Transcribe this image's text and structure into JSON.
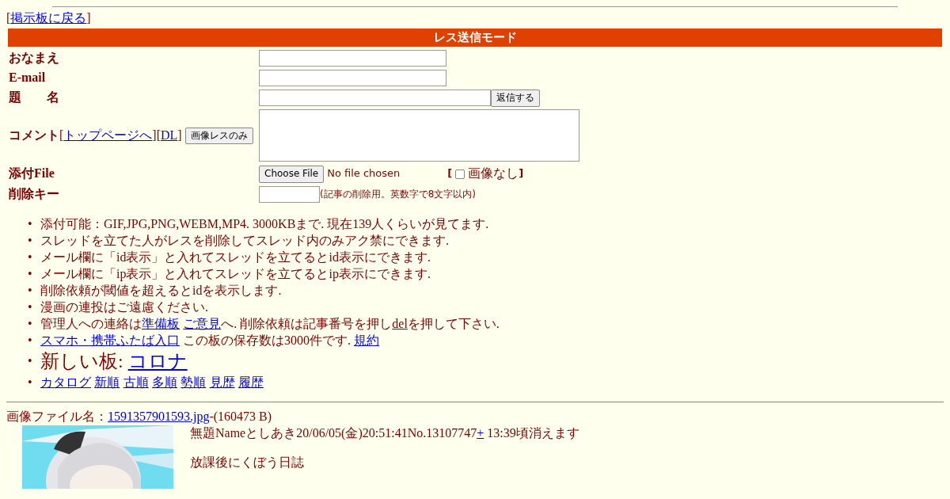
{
  "back_link": [
    {
      "kind": "text",
      "text": "["
    },
    {
      "kind": "link",
      "text": "掲示板に戻る"
    },
    {
      "kind": "text",
      "text": "]"
    }
  ],
  "form": {
    "title": "レス送信モード",
    "name": {
      "label": "おなまえ"
    },
    "email": {
      "label": "E-mail"
    },
    "subject": {
      "label": "題　　名",
      "button": "返信する"
    },
    "comment": {
      "label": "コメント",
      "links": [
        {
          "kind": "text",
          "text": "["
        },
        {
          "kind": "link",
          "text": "トップページへ"
        },
        {
          "kind": "text",
          "text": "]["
        },
        {
          "kind": "link",
          "text": "DL"
        },
        {
          "kind": "text",
          "text": "]"
        }
      ],
      "button": "画像レスのみ"
    },
    "file": {
      "label": "添付File",
      "button": "Choose File",
      "status": "No file chosen",
      "open": "[",
      "checkbox_label": "画像なし",
      "close": "]",
      "checked": false
    },
    "delete_key": {
      "label": "削除キー",
      "hint": "(記事の削除用。英数字で8文字以内)"
    }
  },
  "notes": [
    {
      "kind": "normal",
      "marker": "•",
      "parts": [
        {
          "kind": "text",
          "text": "添付可能：GIF,JPG,PNG,WEBM,MP4. 3000KBまで. 現在139人くらいが見てます."
        }
      ]
    },
    {
      "kind": "normal",
      "marker": "•",
      "parts": [
        {
          "kind": "text",
          "text": "スレッドを立てた人がレスを削除してスレッド内のみアク禁にできます."
        }
      ]
    },
    {
      "kind": "normal",
      "marker": "•",
      "parts": [
        {
          "kind": "text",
          "text": "メール欄に「id表示」と入れてスレッドを立てるとid表示にできます."
        }
      ]
    },
    {
      "kind": "normal",
      "marker": "•",
      "parts": [
        {
          "kind": "text",
          "text": "メール欄に「ip表示」と入れてスレッドを立てるとip表示にできます."
        }
      ]
    },
    {
      "kind": "normal",
      "marker": "•",
      "parts": [
        {
          "kind": "text",
          "text": "削除依頼が閾値を超えるとidを表示します."
        }
      ]
    },
    {
      "kind": "normal",
      "marker": "•",
      "parts": [
        {
          "kind": "text",
          "text": "漫画の連投はご遠慮ください."
        }
      ]
    },
    {
      "kind": "normal",
      "marker": "•",
      "parts": [
        {
          "kind": "text",
          "text": "管理人への連絡は"
        },
        {
          "kind": "link",
          "text": "準備板"
        },
        {
          "kind": "space"
        },
        {
          "kind": "link",
          "text": "ご意見"
        },
        {
          "kind": "text",
          "text": "へ. 削除依頼は記事番号を押し"
        },
        {
          "kind": "underline",
          "text": "del"
        },
        {
          "kind": "text",
          "text": "を押して下さい."
        }
      ]
    },
    {
      "kind": "normal",
      "marker": "•",
      "parts": [
        {
          "kind": "link",
          "text": "スマホ・携帯ふたば入口"
        },
        {
          "kind": "text",
          "text": " この板の保存数は3000件です. "
        },
        {
          "kind": "link",
          "text": "規約"
        }
      ]
    },
    {
      "kind": "large",
      "marker": "•",
      "parts": [
        {
          "kind": "text",
          "text": "新しい板: "
        },
        {
          "kind": "link",
          "text": "コロナ"
        }
      ]
    },
    {
      "kind": "normal",
      "marker": "•",
      "parts": [
        {
          "kind": "link",
          "text": "カタログ"
        },
        {
          "kind": "space"
        },
        {
          "kind": "link",
          "text": "新順"
        },
        {
          "kind": "space"
        },
        {
          "kind": "link",
          "text": "古順"
        },
        {
          "kind": "space"
        },
        {
          "kind": "link",
          "text": "多順"
        },
        {
          "kind": "space"
        },
        {
          "kind": "link",
          "text": "勢順"
        },
        {
          "kind": "space"
        },
        {
          "kind": "link",
          "text": "見歴"
        },
        {
          "kind": "space"
        },
        {
          "kind": "link",
          "text": "履歴"
        }
      ]
    }
  ],
  "post": {
    "file_label": "画像ファイル名：",
    "file_name": "1591357901593.jpg",
    "file_size": "-(160473 B)",
    "subject": "無題",
    "name_label": "Name",
    "name": "としあき",
    "date": "20/06/05(金)20:51:41",
    "number": "No.13107747",
    "plus": "+",
    "expiry": " 13:39頃消えます",
    "body": "放課後にくぼう日誌"
  }
}
